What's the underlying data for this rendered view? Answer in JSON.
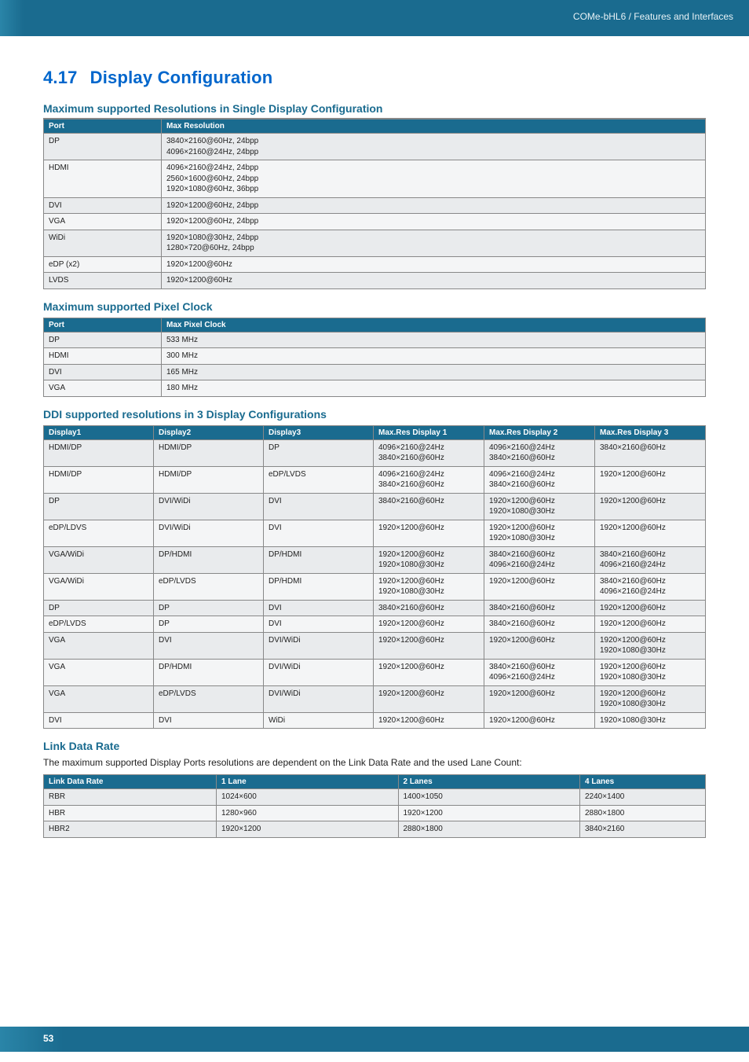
{
  "header": {
    "breadcrumb": "COMe-bHL6 / Features and Interfaces"
  },
  "title": {
    "number": "4.17",
    "text": "Display Configuration"
  },
  "maxRes": {
    "heading": "Maximum supported Resolutions in Single Display Configuration",
    "cols": [
      "Port",
      "Max Resolution"
    ],
    "rows": [
      {
        "port": "DP",
        "res": "3840×2160@60Hz, 24bpp\n4096×2160@24Hz, 24bpp"
      },
      {
        "port": "HDMI",
        "res": "4096×2160@24Hz, 24bpp\n2560×1600@60Hz, 24bpp\n1920×1080@60Hz, 36bpp"
      },
      {
        "port": "DVI",
        "res": "1920×1200@60Hz, 24bpp"
      },
      {
        "port": "VGA",
        "res": "1920×1200@60Hz, 24bpp"
      },
      {
        "port": "WiDi",
        "res": "1920×1080@30Hz, 24bpp\n1280×720@60Hz, 24bpp"
      },
      {
        "port": "eDP (x2)",
        "res": "1920×1200@60Hz"
      },
      {
        "port": "LVDS",
        "res": "1920×1200@60Hz"
      }
    ]
  },
  "pixelClock": {
    "heading": "Maximum supported Pixel Clock",
    "cols": [
      "Port",
      "Max Pixel Clock"
    ],
    "rows": [
      {
        "port": "DP",
        "clk": "533 MHz"
      },
      {
        "port": "HDMI",
        "clk": "300 MHz"
      },
      {
        "port": "DVI",
        "clk": "165 MHz"
      },
      {
        "port": "VGA",
        "clk": "180 MHz"
      }
    ]
  },
  "ddi": {
    "heading": "DDI supported resolutions in 3 Display Configurations",
    "cols": [
      "Display1",
      "Display2",
      "Display3",
      "Max.Res Display 1",
      "Max.Res Display 2",
      "Max.Res Display 3"
    ],
    "rows": [
      {
        "d1": "HDMI/DP",
        "d2": "HDMI/DP",
        "d3": "DP",
        "r1": "4096×2160@24Hz\n3840×2160@60Hz",
        "r2": "4096×2160@24Hz\n3840×2160@60Hz",
        "r3": "3840×2160@60Hz"
      },
      {
        "d1": "HDMI/DP",
        "d2": "HDMI/DP",
        "d3": "eDP/LVDS",
        "r1": "4096×2160@24Hz\n3840×2160@60Hz",
        "r2": "4096×2160@24Hz\n3840×2160@60Hz",
        "r3": "1920×1200@60Hz"
      },
      {
        "d1": "DP",
        "d2": "DVI/WiDi",
        "d3": "DVI",
        "r1": "3840×2160@60Hz",
        "r2": "1920×1200@60Hz\n1920×1080@30Hz",
        "r3": "1920×1200@60Hz"
      },
      {
        "d1": "eDP/LDVS",
        "d2": "DVI/WiDi",
        "d3": "DVI",
        "r1": "1920×1200@60Hz",
        "r2": "1920×1200@60Hz\n1920×1080@30Hz",
        "r3": "1920×1200@60Hz"
      },
      {
        "d1": "VGA/WiDi",
        "d2": "DP/HDMI",
        "d3": "DP/HDMI",
        "r1": "1920×1200@60Hz\n1920×1080@30Hz",
        "r2": "3840×2160@60Hz\n4096×2160@24Hz",
        "r3": "3840×2160@60Hz\n4096×2160@24Hz"
      },
      {
        "d1": "VGA/WiDi",
        "d2": "eDP/LVDS",
        "d3": "DP/HDMI",
        "r1": "1920×1200@60Hz\n1920×1080@30Hz",
        "r2": "1920×1200@60Hz",
        "r3": "3840×2160@60Hz\n4096×2160@24Hz"
      },
      {
        "d1": "DP",
        "d2": "DP",
        "d3": "DVI",
        "r1": "3840×2160@60Hz",
        "r2": "3840×2160@60Hz",
        "r3": "1920×1200@60Hz"
      },
      {
        "d1": "eDP/LVDS",
        "d2": "DP",
        "d3": "DVI",
        "r1": "1920×1200@60Hz",
        "r2": "3840×2160@60Hz",
        "r3": "1920×1200@60Hz"
      },
      {
        "d1": "VGA",
        "d2": "DVI",
        "d3": "DVI/WiDi",
        "r1": "1920×1200@60Hz",
        "r2": "1920×1200@60Hz",
        "r3": "1920×1200@60Hz\n1920×1080@30Hz"
      },
      {
        "d1": "VGA",
        "d2": "DP/HDMI",
        "d3": "DVI/WiDi",
        "r1": "1920×1200@60Hz",
        "r2": "3840×2160@60Hz\n4096×2160@24Hz",
        "r3": "1920×1200@60Hz\n1920×1080@30Hz"
      },
      {
        "d1": "VGA",
        "d2": "eDP/LVDS",
        "d3": "DVI/WiDi",
        "r1": "1920×1200@60Hz",
        "r2": "1920×1200@60Hz",
        "r3": "1920×1200@60Hz\n1920×1080@30Hz"
      },
      {
        "d1": "DVI",
        "d2": "DVI",
        "d3": "WiDi",
        "r1": "1920×1200@60Hz",
        "r2": "1920×1200@60Hz",
        "r3": "1920×1080@30Hz"
      }
    ]
  },
  "linkRate": {
    "heading": "Link Data Rate",
    "intro": "The maximum supported Display Ports resolutions are dependent on the Link Data Rate and the used Lane Count:",
    "cols": [
      "Link Data Rate",
      "1 Lane",
      "2 Lanes",
      "4 Lanes"
    ],
    "rows": [
      {
        "rate": "RBR",
        "l1": "1024×600",
        "l2": "1400×1050",
        "l4": "2240×1400"
      },
      {
        "rate": "HBR",
        "l1": "1280×960",
        "l2": "1920×1200",
        "l4": "2880×1800"
      },
      {
        "rate": "HBR2",
        "l1": "1920×1200",
        "l2": "2880×1800",
        "l4": "3840×2160"
      }
    ]
  },
  "footer": {
    "page": "53"
  }
}
